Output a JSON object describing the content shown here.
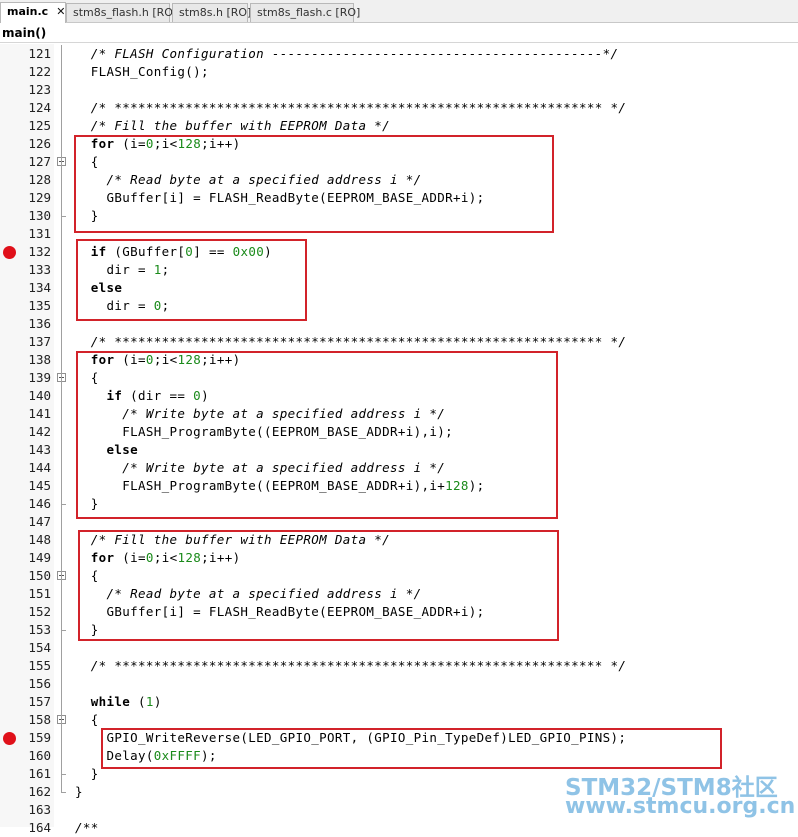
{
  "tabs": [
    {
      "label": "main.c",
      "active": true,
      "close": "✕"
    },
    {
      "label": "stm8s_flash.h [RO]",
      "active": false
    },
    {
      "label": "stm8s.h [RO]",
      "active": false
    },
    {
      "label": "stm8s_flash.c [RO]",
      "active": false
    }
  ],
  "function_selector": "main()",
  "colors": {
    "breakpoint": "#e0101a",
    "highlight_box": "#d2232a",
    "number": "#1a8a1a",
    "watermark": "#8fc3e6"
  },
  "lines": [
    {
      "num": "121",
      "text": "  /* FLASH Configuration ------------------------------------------*/"
    },
    {
      "num": "122",
      "text": "  FLASH_Config();"
    },
    {
      "num": "123",
      "text": ""
    },
    {
      "num": "124",
      "text": "  /* ************************************************************** */"
    },
    {
      "num": "125",
      "text": "  /* Fill the buffer with EEPROM Data */"
    },
    {
      "num": "126",
      "text": "  for (i=0;i<128;i++)"
    },
    {
      "num": "127",
      "text": "  {"
    },
    {
      "num": "128",
      "text": "    /* Read byte at a specified address i */"
    },
    {
      "num": "129",
      "text": "    GBuffer[i] = FLASH_ReadByte(EEPROM_BASE_ADDR+i);"
    },
    {
      "num": "130",
      "text": "  }"
    },
    {
      "num": "131",
      "text": ""
    },
    {
      "num": "132",
      "text": "  if (GBuffer[0] == 0x00)",
      "breakpoint": true
    },
    {
      "num": "133",
      "text": "    dir = 1;"
    },
    {
      "num": "134",
      "text": "  else"
    },
    {
      "num": "135",
      "text": "    dir = 0;"
    },
    {
      "num": "136",
      "text": ""
    },
    {
      "num": "137",
      "text": "  /* ************************************************************** */"
    },
    {
      "num": "138",
      "text": "  for (i=0;i<128;i++)"
    },
    {
      "num": "139",
      "text": "  {"
    },
    {
      "num": "140",
      "text": "    if (dir == 0)"
    },
    {
      "num": "141",
      "text": "      /* Write byte at a specified address i */"
    },
    {
      "num": "142",
      "text": "      FLASH_ProgramByte((EEPROM_BASE_ADDR+i),i);"
    },
    {
      "num": "143",
      "text": "    else"
    },
    {
      "num": "144",
      "text": "      /* Write byte at a specified address i */"
    },
    {
      "num": "145",
      "text": "      FLASH_ProgramByte((EEPROM_BASE_ADDR+i),i+128);"
    },
    {
      "num": "146",
      "text": "  }"
    },
    {
      "num": "147",
      "text": ""
    },
    {
      "num": "148",
      "text": "  /* Fill the buffer with EEPROM Data */"
    },
    {
      "num": "149",
      "text": "  for (i=0;i<128;i++)"
    },
    {
      "num": "150",
      "text": "  {"
    },
    {
      "num": "151",
      "text": "    /* Read byte at a specified address i */"
    },
    {
      "num": "152",
      "text": "    GBuffer[i] = FLASH_ReadByte(EEPROM_BASE_ADDR+i);"
    },
    {
      "num": "153",
      "text": "  }"
    },
    {
      "num": "154",
      "text": ""
    },
    {
      "num": "155",
      "text": "  /* ************************************************************** */"
    },
    {
      "num": "156",
      "text": ""
    },
    {
      "num": "157",
      "text": "  while (1)"
    },
    {
      "num": "158",
      "text": "  {"
    },
    {
      "num": "159",
      "text": "    GPIO_WriteReverse(LED_GPIO_PORT, (GPIO_Pin_TypeDef)LED_GPIO_PINS);",
      "breakpoint": true
    },
    {
      "num": "160",
      "text": "    Delay(0xFFFF);"
    },
    {
      "num": "161",
      "text": "  }"
    },
    {
      "num": "162",
      "text": "}"
    },
    {
      "num": "163",
      "text": ""
    },
    {
      "num": "164",
      "text": "/**"
    }
  ],
  "watermark": {
    "line1": "STM32/STM8社区",
    "line2": "www.stmcu.org.cn"
  }
}
